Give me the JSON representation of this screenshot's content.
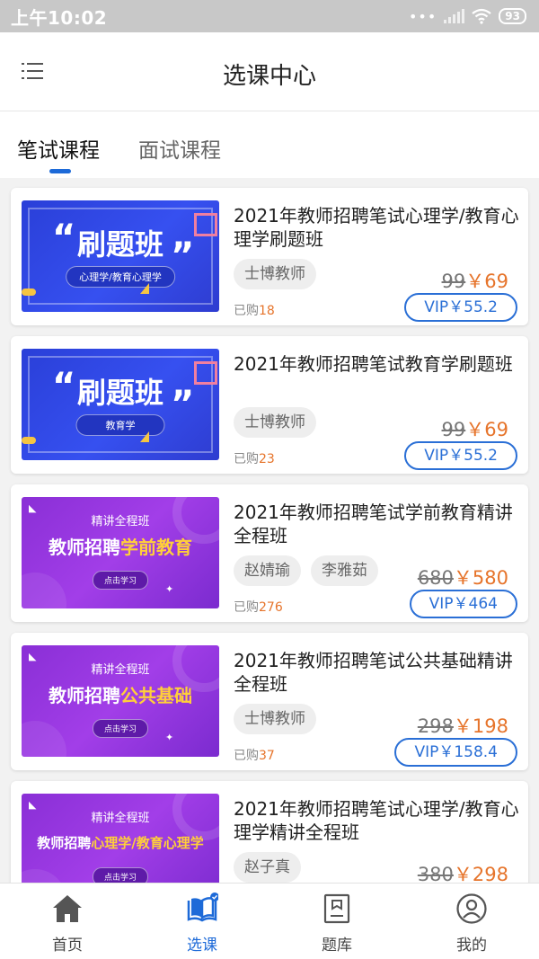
{
  "status_bar": {
    "time": "上午10:02",
    "battery": "93"
  },
  "header": {
    "title": "选课中心"
  },
  "tabs": [
    {
      "label": "笔试课程",
      "active": true
    },
    {
      "label": "面试课程",
      "active": false
    }
  ],
  "courses": [
    {
      "title": "2021年教师招聘笔试心理学/教育心理学刷题班",
      "thumb": {
        "style": "blue",
        "headline": "刷题班",
        "subtitle": "心理学/教育心理学"
      },
      "teachers": [
        "士博教师"
      ],
      "bought_label": "已购",
      "bought_count": "18",
      "old_price": "99",
      "price": "￥69",
      "vip_price": "VIP￥55.2"
    },
    {
      "title": "2021年教师招聘笔试教育学刷题班",
      "thumb": {
        "style": "blue",
        "headline": "刷题班",
        "subtitle": "教育学"
      },
      "teachers": [
        "士博教师"
      ],
      "bought_label": "已购",
      "bought_count": "23",
      "old_price": "99",
      "price": "￥69",
      "vip_price": "VIP￥55.2"
    },
    {
      "title": "2021年教师招聘笔试学前教育精讲全程班",
      "thumb": {
        "style": "purple",
        "top": "精讲全程班",
        "main_white": "教师招聘",
        "main_yellow": "学前教育",
        "button": "点击学习"
      },
      "teachers": [
        "赵婧瑜",
        "李雅茹"
      ],
      "bought_label": "已购",
      "bought_count": "276",
      "old_price": "680",
      "price": "￥580",
      "vip_price": "VIP￥464"
    },
    {
      "title": "2021年教师招聘笔试公共基础精讲全程班",
      "thumb": {
        "style": "purple",
        "top": "精讲全程班",
        "main_white": "教师招聘",
        "main_yellow": "公共基础",
        "button": "点击学习"
      },
      "teachers": [
        "士博教师"
      ],
      "bought_label": "已购",
      "bought_count": "37",
      "old_price": "298",
      "price": "￥198",
      "vip_price": "VIP￥158.4"
    },
    {
      "title": "2021年教师招聘笔试心理学/教育心理学精讲全程班",
      "thumb": {
        "style": "purple",
        "top": "精讲全程班",
        "main_white": "教师招聘",
        "main_yellow": "心理学/教育心理学",
        "button": "点击学习"
      },
      "teachers": [
        "赵子真"
      ],
      "bought_label": "",
      "bought_count": "",
      "old_price": "380",
      "price": "￥298",
      "vip_price": ""
    }
  ],
  "tab_bar": [
    {
      "label": "首页",
      "icon": "home-icon",
      "active": false
    },
    {
      "label": "选课",
      "icon": "book-icon",
      "active": true
    },
    {
      "label": "题库",
      "icon": "question-bank-icon",
      "active": false
    },
    {
      "label": "我的",
      "icon": "profile-icon",
      "active": false
    }
  ],
  "colors": {
    "accent": "#1d6ad8",
    "price": "#e6742b",
    "vip": "#2a6fd6"
  }
}
